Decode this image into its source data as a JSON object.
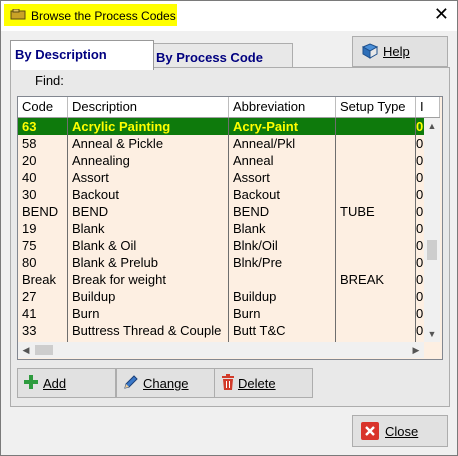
{
  "window": {
    "title": "Browse the Process Codes"
  },
  "tabs": [
    {
      "label": "By Description",
      "active": true
    },
    {
      "label": "By Process Code",
      "active": false
    }
  ],
  "help_button": {
    "label": "Help",
    "icon": "book-icon"
  },
  "find": {
    "label": "Find:"
  },
  "grid": {
    "columns": [
      "Code",
      "Description",
      "Abbreviation",
      "Setup Type",
      "I"
    ],
    "rows": [
      {
        "code": "63",
        "description": "Acrylic Painting",
        "abbreviation": "Acry-Paint",
        "setup_type": "",
        "extra": "0",
        "selected": true
      },
      {
        "code": "58",
        "description": "Anneal & Pickle",
        "abbreviation": "Anneal/Pkl",
        "setup_type": "",
        "extra": "0"
      },
      {
        "code": "20",
        "description": "Annealing",
        "abbreviation": "Anneal",
        "setup_type": "",
        "extra": "0"
      },
      {
        "code": "40",
        "description": "Assort",
        "abbreviation": "Assort",
        "setup_type": "",
        "extra": "0"
      },
      {
        "code": "30",
        "description": "Backout",
        "abbreviation": "Backout",
        "setup_type": "",
        "extra": "0"
      },
      {
        "code": "BEND",
        "description": "BEND",
        "abbreviation": "BEND",
        "setup_type": "TUBE",
        "extra": "0"
      },
      {
        "code": "19",
        "description": "Blank",
        "abbreviation": "Blank",
        "setup_type": "",
        "extra": "0"
      },
      {
        "code": "75",
        "description": "Blank & Oil",
        "abbreviation": "Blnk/Oil",
        "setup_type": "",
        "extra": "0"
      },
      {
        "code": "80",
        "description": "Blank & Prelub",
        "abbreviation": "Blnk/Pre",
        "setup_type": "",
        "extra": "0"
      },
      {
        "code": "Break",
        "description": "Break for weight",
        "abbreviation": "",
        "setup_type": "BREAK",
        "extra": "0"
      },
      {
        "code": "27",
        "description": "Buildup",
        "abbreviation": "Buildup",
        "setup_type": "",
        "extra": "0"
      },
      {
        "code": "41",
        "description": "Burn",
        "abbreviation": "Burn",
        "setup_type": "",
        "extra": "0"
      },
      {
        "code": "33",
        "description": "Buttress Thread & Couple",
        "abbreviation": "Butt T&C",
        "setup_type": "",
        "extra": "0"
      }
    ]
  },
  "actions": [
    {
      "label": "Add",
      "icon": "plus-icon"
    },
    {
      "label": "Change",
      "icon": "pencil-icon"
    },
    {
      "label": "Delete",
      "icon": "trash-icon"
    }
  ],
  "close_button": {
    "label": "Close",
    "icon": "close-x-icon"
  },
  "colors": {
    "selected_row_bg": "#0e7a0c",
    "selected_row_text": "#ffff00",
    "grid_bg": "#fdefe2",
    "title_highlight": "#ffff00"
  }
}
